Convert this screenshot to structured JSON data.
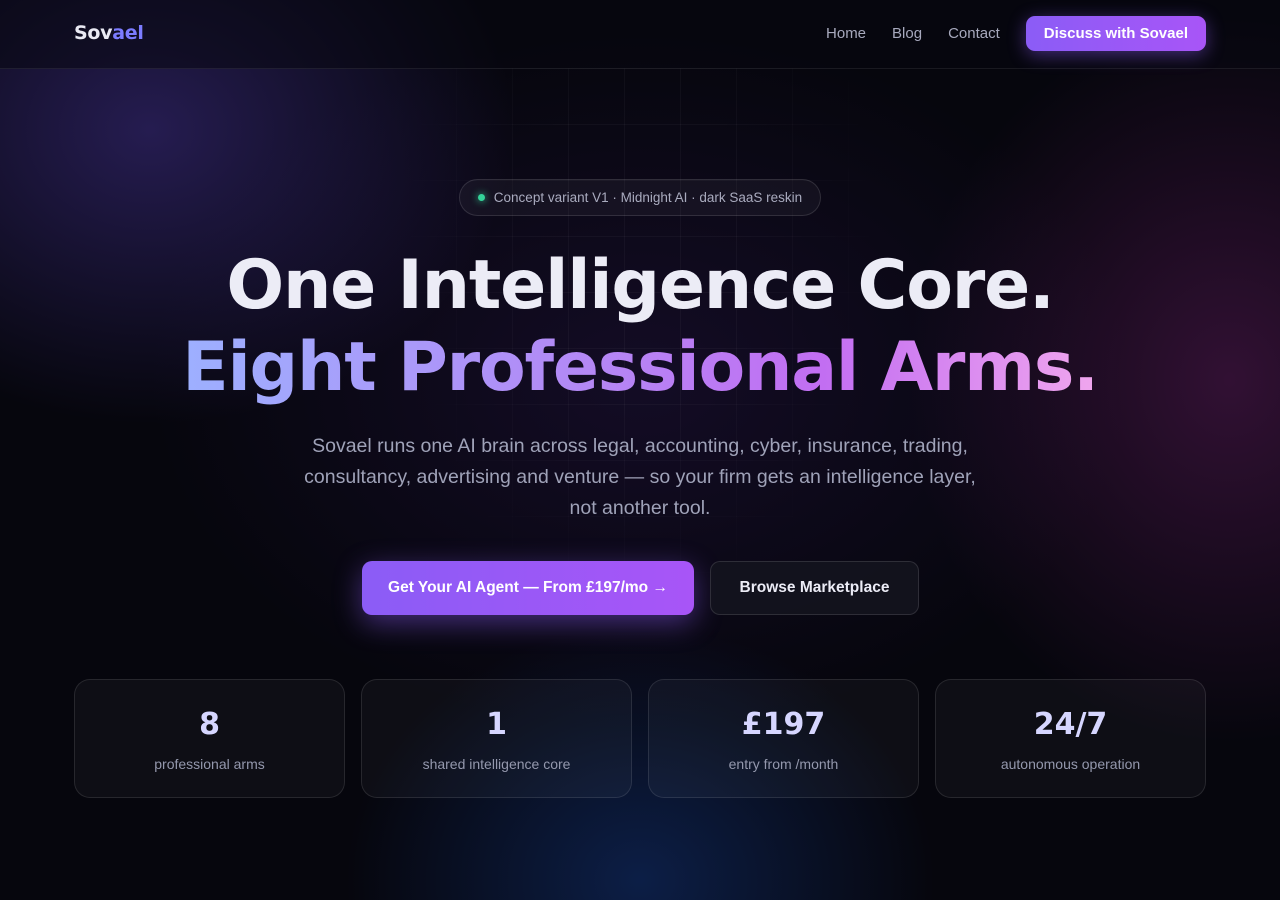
{
  "nav": {
    "logo_primary": "Sov",
    "logo_accent": "ael",
    "links": [
      {
        "label": "Home"
      },
      {
        "label": "Blog"
      },
      {
        "label": "Contact"
      }
    ],
    "cta_label": "Discuss with Sovael"
  },
  "hero": {
    "badge_text": "Concept variant V1 · Midnight AI · dark SaaS reskin",
    "headline_line1": "One Intelligence Core.",
    "headline_line2": "Eight Professional Arms.",
    "subheadline": "Sovael runs one AI brain across legal, accounting, cyber, insurance, trading, consultancy, advertising and venture — so your firm gets an intelligence layer, not another tool.",
    "primary_cta": "Get Your AI Agent — From £197/mo →",
    "secondary_cta": "Browse Marketplace"
  },
  "stats": [
    {
      "value": "8",
      "label": "professional arms"
    },
    {
      "value": "1",
      "label": "shared intelligence core"
    },
    {
      "value": "£197",
      "label": "entry from /month"
    },
    {
      "value": "24/7",
      "label": "autonomous operation"
    }
  ],
  "colors": {
    "accent": "#8b5cf6",
    "accent_2": "#a855f7",
    "logo_accent": "#7c7cff",
    "status_dot": "#34d399",
    "background": "#06060d"
  }
}
